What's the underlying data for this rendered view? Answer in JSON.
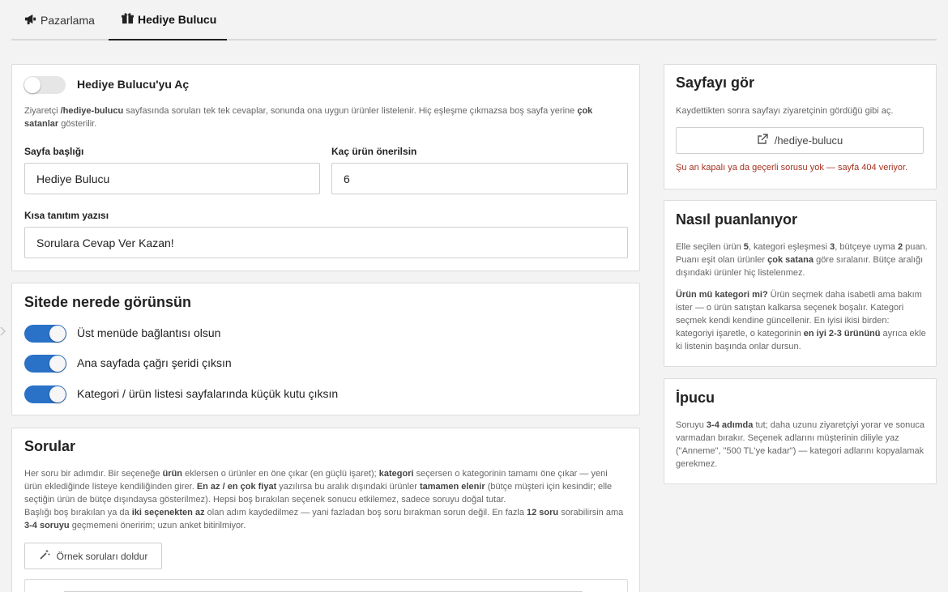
{
  "tabs": [
    {
      "label": "Pazarlama",
      "icon": "megaphone-icon"
    },
    {
      "label": "Hediye Bulucu",
      "icon": "gift-icon"
    }
  ],
  "main": {
    "enable": {
      "label": "Hediye Bulucu'yu Aç",
      "on": false,
      "help": [
        {
          "t": "Ziyaretçi ",
          "b": false
        },
        {
          "t": "/hediye-bulucu",
          "b": true
        },
        {
          "t": " sayfasında soruları tek tek cevaplar, sonunda ona uygun ürünler listelenir. Hiç eşleşme çıkmazsa boş sayfa yerine ",
          "b": false
        },
        {
          "t": "çok satanlar",
          "b": true
        },
        {
          "t": " gösterilir.",
          "b": false
        }
      ]
    },
    "page_title_label": "Sayfa başlığı",
    "page_title_value": "Hediye Bulucu",
    "count_label": "Kaç ürün önerilsin",
    "count_value": "6",
    "intro_label": "Kısa tanıtım yazısı",
    "intro_value": "Sorulara Cevap Ver Kazan!"
  },
  "placement": {
    "title": "Sitede nerede görünsün",
    "items": [
      {
        "label": "Üst menüde bağlantısı olsun",
        "on": true
      },
      {
        "label": "Ana sayfada çağrı şeridi çıksın",
        "on": true
      },
      {
        "label": "Kategori / ürün listesi sayfalarında küçük kutu çıksın",
        "on": true
      }
    ]
  },
  "questions": {
    "title": "Sorular",
    "help_lines": [
      [
        {
          "t": "Her soru bir adımdır. Bir seçeneğe ",
          "b": false
        },
        {
          "t": "ürün",
          "b": true
        },
        {
          "t": " eklersen o ürünler en öne çıkar (en güçlü işaret); ",
          "b": false
        },
        {
          "t": "kategori",
          "b": true
        },
        {
          "t": " seçersen o kategorinin tamamı öne çıkar — yeni",
          "b": false
        }
      ],
      [
        {
          "t": "ürün eklediğinde listeye kendiliğinden girer. ",
          "b": false
        },
        {
          "t": "En az / en çok fiyat",
          "b": true
        },
        {
          "t": " yazılırsa bu aralık dışındaki ürünler ",
          "b": false
        },
        {
          "t": "tamamen elenir",
          "b": true
        },
        {
          "t": " (bütçe müşteri için kesindir; elle",
          "b": false
        }
      ],
      [
        {
          "t": "seçtiğin ürün de bütçe dışındaysa gösterilmez). Hepsi boş bırakılan seçenek sonucu etkilemez, sadece soruyu doğal tutar.",
          "b": false
        }
      ],
      [
        {
          "t": "Başlığı boş bırakılan ya da ",
          "b": false
        },
        {
          "t": "iki seçenekten az",
          "b": true
        },
        {
          "t": " olan adım kaydedilmez — yani fazladan boş soru bırakman sorun değil. En fazla ",
          "b": false
        },
        {
          "t": "12 soru",
          "b": true
        },
        {
          "t": " sorabilirsin ama",
          "b": false
        }
      ],
      [
        {
          "t": "3-4 soruyu",
          "b": true
        },
        {
          "t": " geçmemeni öneririm; uzun anket bitirilmiyor.",
          "b": false
        }
      ]
    ],
    "fill_button": "Örnek soruları doldur"
  },
  "side": {
    "view": {
      "title": "Sayfayı gör",
      "help": "Kaydettikten sonra sayfayı ziyaretçinin gördüğü gibi aç.",
      "link": "/hediye-bulucu",
      "error": "Şu an kapalı ya da geçerli sorusu yok — sayfa 404 veriyor."
    },
    "scoring": {
      "title": "Nasıl puanlanıyor",
      "p1": [
        {
          "t": "Elle seçilen ürün ",
          "b": false
        },
        {
          "t": "5",
          "b": true
        },
        {
          "t": ", kategori eşleşmesi ",
          "b": false
        },
        {
          "t": "3",
          "b": true
        },
        {
          "t": ", bütçeye uyma ",
          "b": false
        },
        {
          "t": "2",
          "b": true
        },
        {
          "t": " puan. Puanı eşit olan ürünler ",
          "b": false
        },
        {
          "t": "çok satana",
          "b": true
        },
        {
          "t": " göre sıralanır. Bütçe aralığı dışındaki ürünler hiç listelenmez.",
          "b": false
        }
      ],
      "p2": [
        {
          "t": "Ürün mü kategori mi?",
          "b": true
        },
        {
          "t": " Ürün seçmek daha isabetli ama bakım ister — o ürün satıştan kalkarsa seçenek boşalır. Kategori seçmek kendi kendine güncellenir. En iyisi ikisi birden: kategoriyi işaretle, o kategorinin ",
          "b": false
        },
        {
          "t": "en iyi 2-3 ürününü",
          "b": true
        },
        {
          "t": " ayrıca ekle ki listenin başında onlar dursun.",
          "b": false
        }
      ]
    },
    "tip": {
      "title": "İpucu",
      "p": [
        {
          "t": "Soruyu ",
          "b": false
        },
        {
          "t": "3-4 adımda",
          "b": true
        },
        {
          "t": " tut; daha uzunu ziyaretçiyi yorar ve sonuca varmadan bırakır. Seçenek adlarını müşterinin diliyle yaz (\"Anneme\", \"500 TL'ye kadar\") — kategori adlarını kopyalamak gerekmez.",
          "b": false
        }
      ]
    }
  },
  "colors": {
    "accent": "#2a72c8",
    "error": "#a6321f",
    "background": "#f3f3f3"
  }
}
